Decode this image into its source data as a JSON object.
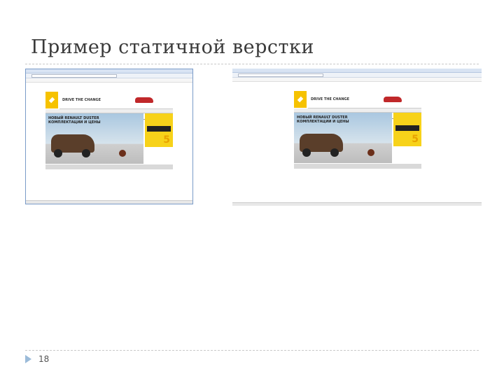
{
  "slide": {
    "title": "Пример статичной верстки",
    "page_number": "18"
  },
  "screenshots": [
    {
      "banner_title": "НОВЫЙ RENAULT DUSTER",
      "banner_sub": "КОМПЛЕКТАЦИИ И ЦЕНЫ",
      "slogan": "DRIVE THE CHANGE",
      "promo_number": "5"
    },
    {
      "banner_title": "НОВЫЙ RENAULT DUSTER",
      "banner_sub": "КОМПЛЕКТАЦИИ И ЦЕНЫ",
      "slogan": "DRIVE THE CHANGE",
      "promo_number": "5"
    }
  ],
  "colors": {
    "accent": "#9bbbd9",
    "brand_yellow": "#f7d21a",
    "frame": "#7a9bc8"
  }
}
